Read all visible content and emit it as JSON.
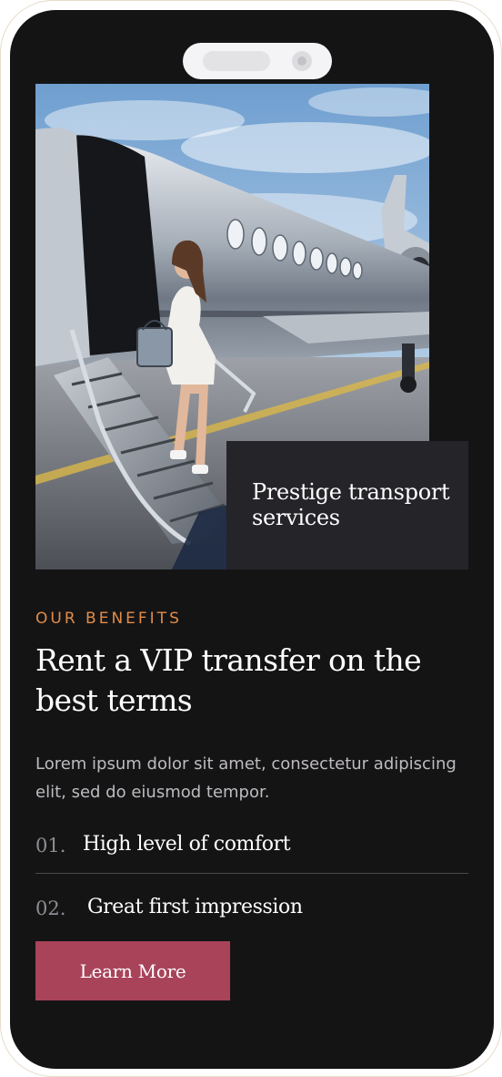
{
  "hero": {
    "image_alt": "Woman descending private jet stairs",
    "overlay_text": "Prestige transport services"
  },
  "benefits_section": {
    "eyebrow": "OUR BENEFITS",
    "headline": "Rent a VIP transfer on the best terms",
    "description": "Lorem ipsum dolor sit amet, consectetur adipiscing elit, sed do eiusmod tempor.",
    "items": [
      {
        "number": "01.",
        "label": "High level of comfort"
      },
      {
        "number": "02.",
        "label": "Great first impression"
      }
    ],
    "cta_label": "Learn More"
  },
  "colors": {
    "screen_background": "#151415",
    "eyebrow_accent": "#e08c4a",
    "cta_background": "#a8435a",
    "overlay_box": "#252429"
  }
}
